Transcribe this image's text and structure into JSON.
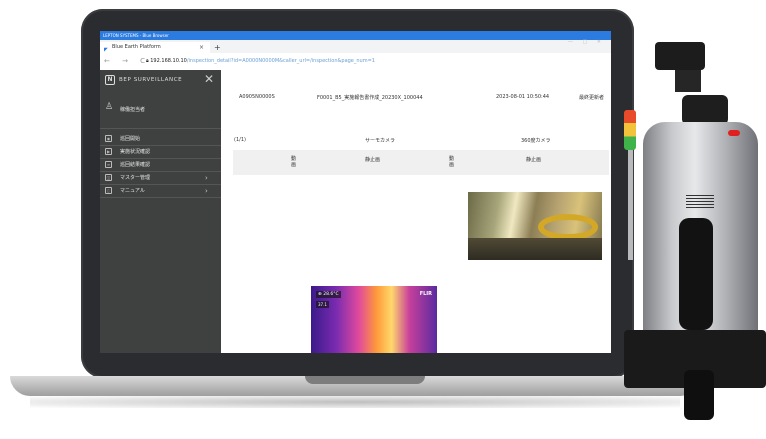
{
  "browser": {
    "title_bar_text": "LEPTON SYSTEMS - Blue Browser",
    "tab_title": "Blue Earth Platform",
    "tab_close": "×",
    "new_tab": "+",
    "window_controls": "— □ ✕",
    "nav_buttons": "← → C",
    "url_host": "192.168.10.10",
    "url_path": "/inspection_detail?id=A0000N0000M&caller_url=/inspection&page_num=1"
  },
  "sidebar": {
    "logo_text": "BEP SURVEILLANCE",
    "close_glyph": "✕",
    "user_name": "稼働担当者",
    "items": [
      {
        "label": "巡回開始",
        "icon": "camera-icon"
      },
      {
        "label": "実施状況確認",
        "icon": "screen-icon"
      },
      {
        "label": "巡回結果確認",
        "icon": "list-icon"
      },
      {
        "label": "マスター管理",
        "icon": "database-icon",
        "chevron": "›"
      },
      {
        "label": "マニュアル",
        "icon": "book-icon",
        "chevron": "›"
      }
    ]
  },
  "main": {
    "record_id": "A0905N0000S",
    "record_name": "F0001_B5_実施報告書作成_20230X_100044",
    "record_time": "2023-08-01 10:50:44",
    "record_extra": "最終更新者",
    "section_label": "(1/1)",
    "col_thermo": "サーモカメラ",
    "col_360": "360度カメラ",
    "thermo_video": "動画",
    "thermo_still": "静止画",
    "cam360_video": "動画",
    "cam360_still": "静止画",
    "thermal_temp": "⊕ 28.6°C",
    "thermal_temp2": "37.1",
    "thermal_brand": "FLIR"
  }
}
